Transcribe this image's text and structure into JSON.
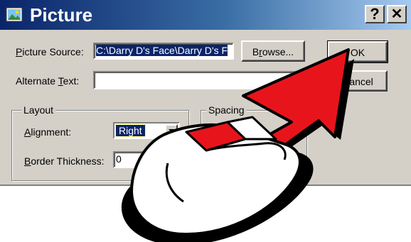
{
  "window": {
    "title": "Picture",
    "help_glyph": "?",
    "close_glyph": "✕"
  },
  "form": {
    "picture_source": {
      "label_u": "P",
      "label_rest": "icture Source:",
      "value": "C:\\Darry D's Face\\Darry D's F",
      "browse_label_pre": "B",
      "browse_label_u": "r",
      "browse_label_post": "owse..."
    },
    "alternate_text": {
      "label_pre": "Alternate ",
      "label_u": "T",
      "label_rest": "ext:",
      "value": ""
    },
    "ok_label": "OK",
    "cancel_label": "Cancel"
  },
  "layout_group": {
    "title": "Layout",
    "alignment": {
      "label_u": "A",
      "label_rest": "lignment:",
      "value": "Right"
    },
    "border": {
      "label_u": "B",
      "label_rest": "order Thickness:",
      "value": "0"
    }
  },
  "spacing_group": {
    "title": "Spacing"
  },
  "overlay": {
    "arrow_color": "#e8141b",
    "mouse_color": "#ffffff"
  }
}
